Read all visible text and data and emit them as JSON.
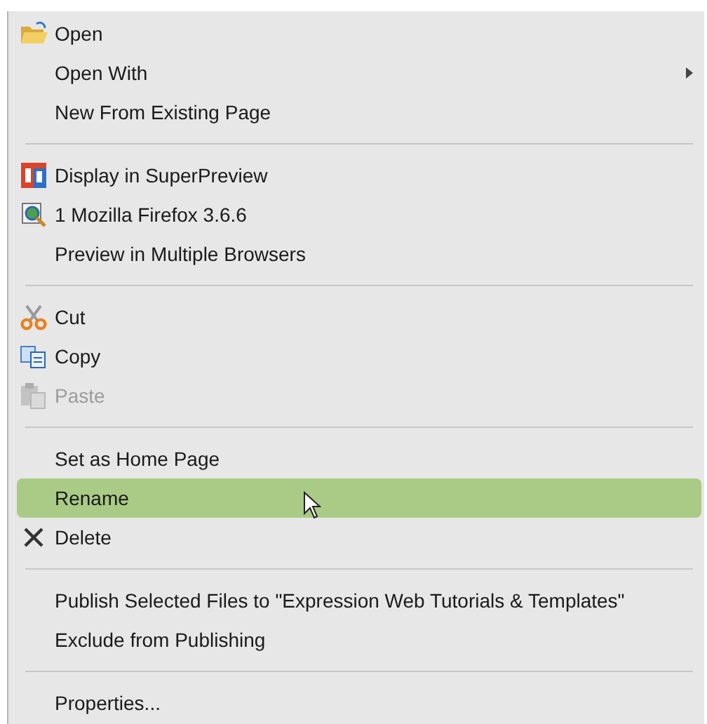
{
  "context_menu": {
    "items": [
      {
        "kind": "item",
        "label": "Open",
        "disabled": false,
        "selected": false
      },
      {
        "kind": "item",
        "label": "Open With",
        "disabled": false,
        "selected": false,
        "submenu": true
      },
      {
        "kind": "item",
        "label": "New From Existing Page",
        "disabled": false,
        "selected": false
      },
      {
        "kind": "separator"
      },
      {
        "kind": "item",
        "label": "Display in SuperPreview",
        "disabled": false,
        "selected": false
      },
      {
        "kind": "item",
        "label": "1 Mozilla Firefox 3.6.6",
        "disabled": false,
        "selected": false
      },
      {
        "kind": "item",
        "label": "Preview in Multiple Browsers",
        "disabled": false,
        "selected": false
      },
      {
        "kind": "separator"
      },
      {
        "kind": "item",
        "label": "Cut",
        "disabled": false,
        "selected": false
      },
      {
        "kind": "item",
        "label": "Copy",
        "disabled": false,
        "selected": false
      },
      {
        "kind": "item",
        "label": "Paste",
        "disabled": true,
        "selected": false
      },
      {
        "kind": "separator"
      },
      {
        "kind": "item",
        "label": "Set as Home Page",
        "disabled": false,
        "selected": false
      },
      {
        "kind": "item",
        "label": "Rename",
        "disabled": false,
        "selected": true
      },
      {
        "kind": "item",
        "label": "Delete",
        "disabled": false,
        "selected": false
      },
      {
        "kind": "separator"
      },
      {
        "kind": "item",
        "label": "Publish Selected Files to \"Expression Web Tutorials & Templates\"",
        "disabled": false,
        "selected": false
      },
      {
        "kind": "item",
        "label": "Exclude from Publishing",
        "disabled": false,
        "selected": false
      },
      {
        "kind": "separator"
      },
      {
        "kind": "item",
        "label": "Properties...",
        "disabled": false,
        "selected": false
      }
    ]
  }
}
